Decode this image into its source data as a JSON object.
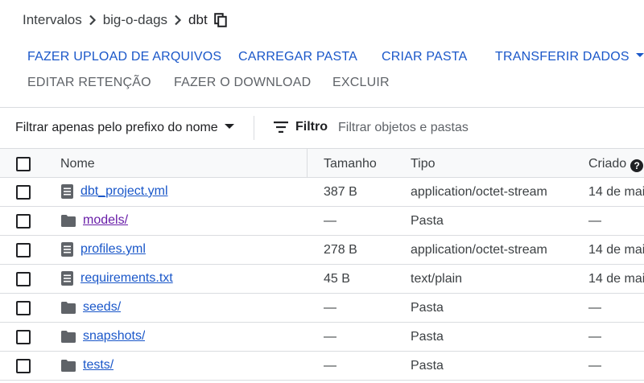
{
  "breadcrumb": {
    "items": [
      "Intervalos",
      "big-o-dags"
    ],
    "current": "dbt"
  },
  "actions": {
    "upload_files": "FAZER UPLOAD DE ARQUIVOS",
    "upload_folder": "CARREGAR PASTA",
    "create_folder": "CRIAR PASTA",
    "transfer_data": "TRANSFERIR DADOS",
    "edit_retention": "EDITAR RETENÇÃO",
    "download": "FAZER O DOWNLOAD",
    "delete": "EXCLUIR"
  },
  "filterbar": {
    "prefix_label": "Filtrar apenas pelo prefixo do nome",
    "filter_label": "Filtro",
    "filter_placeholder": "Filtrar objetos e pastas"
  },
  "table": {
    "headers": {
      "name": "Nome",
      "size": "Tamanho",
      "type": "Tipo",
      "created": "Criado"
    },
    "rows": [
      {
        "kind": "file",
        "name": "dbt_project.yml",
        "size": "387 B",
        "type": "application/octet-stream",
        "created": "14 de mai"
      },
      {
        "kind": "folder",
        "name": "models/",
        "size": "—",
        "type": "Pasta",
        "created": "—",
        "visited": true
      },
      {
        "kind": "file",
        "name": "profiles.yml",
        "size": "278 B",
        "type": "application/octet-stream",
        "created": "14 de mai"
      },
      {
        "kind": "file",
        "name": "requirements.txt",
        "size": "45 B",
        "type": "text/plain",
        "created": "14 de mai"
      },
      {
        "kind": "folder",
        "name": "seeds/",
        "size": "—",
        "type": "Pasta",
        "created": "—"
      },
      {
        "kind": "folder",
        "name": "snapshots/",
        "size": "—",
        "type": "Pasta",
        "created": "—"
      },
      {
        "kind": "folder",
        "name": "tests/",
        "size": "—",
        "type": "Pasta",
        "created": "—"
      }
    ]
  },
  "colors": {
    "action_blue": "#1a57c9",
    "visited_link": "#681da8",
    "icon_gray": "#5f6368",
    "divider": "#dadce0"
  },
  "icons": {
    "breadcrumb_sep": "chevron-right-icon",
    "copy": "copy-icon",
    "filter": "filter-icon",
    "help": "help-icon",
    "file": "file-icon",
    "folder": "folder-icon"
  }
}
